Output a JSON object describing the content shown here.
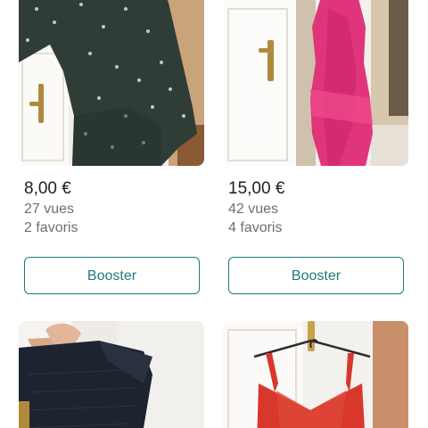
{
  "items": [
    {
      "price": "8,00 €",
      "views": "27 vues",
      "favorites": "2 favoris",
      "boost_label": "Booster",
      "photo_icon": "floral-dress-photo"
    },
    {
      "price": "15,00 €",
      "views": "42 vues",
      "favorites": "4 favoris",
      "boost_label": "Booster",
      "photo_icon": "pink-dress-photo"
    },
    {
      "photo_icon": "black-boots-photo"
    },
    {
      "photo_icon": "red-dress-photo"
    }
  ],
  "colors": {
    "accent": "#1f7a7a",
    "price_text": "#1f1f1f",
    "meta_text": "#6f6f6f"
  }
}
